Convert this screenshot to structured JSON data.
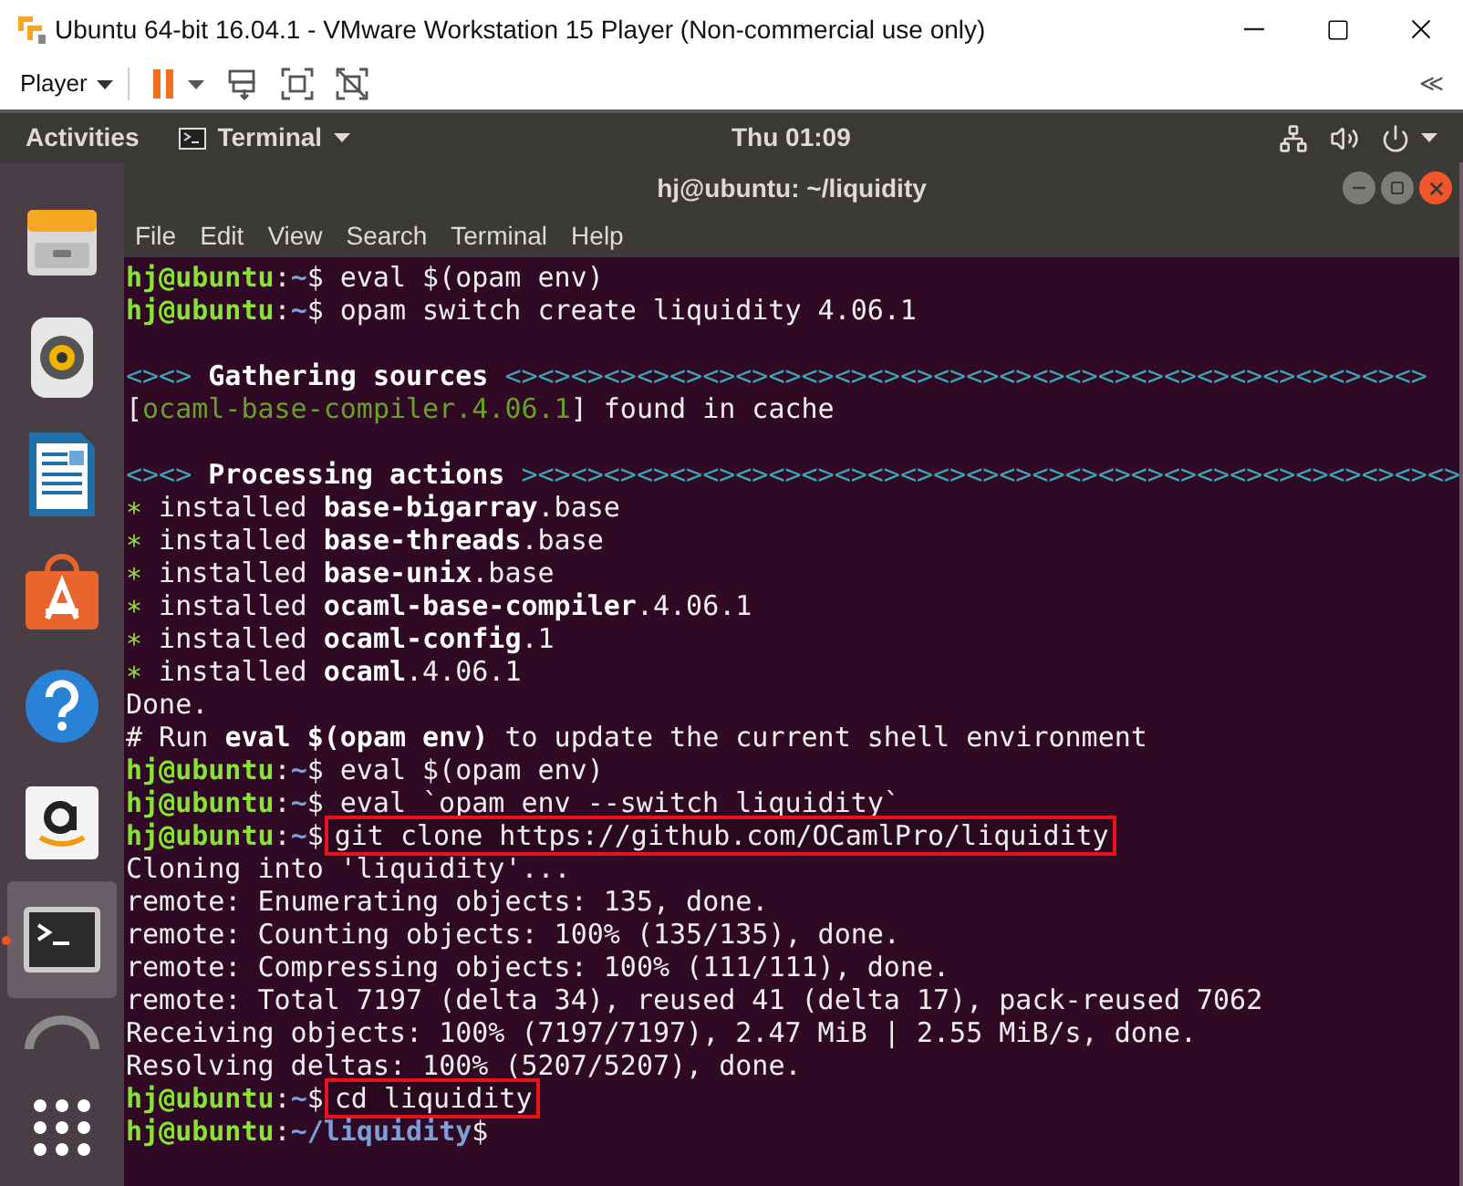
{
  "vmware": {
    "title": "Ubuntu 64-bit 16.04.1 - VMware Workstation 15 Player (Non-commercial use only)",
    "player_menu": "Player",
    "collapse": "≪"
  },
  "topbar": {
    "activities": "Activities",
    "app_menu": "Terminal",
    "clock": "Thu 01:09"
  },
  "launcher": [
    {
      "kind": "files",
      "selected": false
    },
    {
      "kind": "speaker",
      "selected": false
    },
    {
      "kind": "document",
      "selected": false
    },
    {
      "kind": "store",
      "selected": false
    },
    {
      "kind": "help",
      "selected": false
    },
    {
      "kind": "amazon",
      "selected": false
    },
    {
      "kind": "terminal",
      "selected": true
    },
    {
      "kind": "partial",
      "selected": false
    },
    {
      "kind": "apps",
      "selected": false
    }
  ],
  "terminal": {
    "title": "hj@ubuntu: ~/liquidity",
    "menu": [
      "File",
      "Edit",
      "View",
      "Search",
      "Terminal",
      "Help"
    ],
    "lines": [
      {
        "kind": "prompt",
        "user": "hj@ubuntu",
        "sep": ":",
        "path": "~",
        "dollar": "$",
        "command": "eval $(opam env)",
        "boxed": false
      },
      {
        "kind": "prompt",
        "user": "hj@ubuntu",
        "sep": ":",
        "path": "~",
        "dollar": "$",
        "command": "opam switch create liquidity 4.06.1",
        "boxed": false
      },
      {
        "kind": "blank"
      },
      {
        "kind": "output",
        "segments": [
          {
            "text": "<><>",
            "kind": "divider"
          },
          {
            "text": " Gathering sources ",
            "kind": "bold"
          },
          {
            "text": "<><><><><><><><><><><><><><><><><><><><><><><><><><><><>",
            "kind": "divider"
          }
        ]
      },
      {
        "kind": "output",
        "segments": [
          {
            "text": "[",
            "kind": "text"
          },
          {
            "text": "ocaml-base-compiler.4.06.1",
            "kind": "package"
          },
          {
            "text": "] found in cache",
            "kind": "text"
          }
        ]
      },
      {
        "kind": "blank"
      },
      {
        "kind": "output",
        "segments": [
          {
            "text": "<><>",
            "kind": "divider"
          },
          {
            "text": " Processing actions ",
            "kind": "bold"
          },
          {
            "text": "><><><><><><><><><><><><><><><><><><><><><><><><><><><><>",
            "kind": "divider"
          }
        ]
      },
      {
        "kind": "output",
        "segments": [
          {
            "text": "∗",
            "kind": "bullet"
          },
          {
            "text": " installed ",
            "kind": "text"
          },
          {
            "text": "base-bigarray",
            "kind": "bold"
          },
          {
            "text": ".base",
            "kind": "text"
          }
        ]
      },
      {
        "kind": "output",
        "segments": [
          {
            "text": "∗",
            "kind": "bullet"
          },
          {
            "text": " installed ",
            "kind": "text"
          },
          {
            "text": "base-threads",
            "kind": "bold"
          },
          {
            "text": ".base",
            "kind": "text"
          }
        ]
      },
      {
        "kind": "output",
        "segments": [
          {
            "text": "∗",
            "kind": "bullet"
          },
          {
            "text": " installed ",
            "kind": "text"
          },
          {
            "text": "base-unix",
            "kind": "bold"
          },
          {
            "text": ".base",
            "kind": "text"
          }
        ]
      },
      {
        "kind": "output",
        "segments": [
          {
            "text": "∗",
            "kind": "bullet"
          },
          {
            "text": " installed ",
            "kind": "text"
          },
          {
            "text": "ocaml-base-compiler",
            "kind": "bold"
          },
          {
            "text": ".4.06.1",
            "kind": "text"
          }
        ]
      },
      {
        "kind": "output",
        "segments": [
          {
            "text": "∗",
            "kind": "bullet"
          },
          {
            "text": " installed ",
            "kind": "text"
          },
          {
            "text": "ocaml-config",
            "kind": "bold"
          },
          {
            "text": ".1",
            "kind": "text"
          }
        ]
      },
      {
        "kind": "output",
        "segments": [
          {
            "text": "∗",
            "kind": "bullet"
          },
          {
            "text": " installed ",
            "kind": "text"
          },
          {
            "text": "ocaml",
            "kind": "bold"
          },
          {
            "text": ".4.06.1",
            "kind": "text"
          }
        ]
      },
      {
        "kind": "output",
        "segments": [
          {
            "text": "Done.",
            "kind": "text"
          }
        ]
      },
      {
        "kind": "output",
        "segments": [
          {
            "text": "# Run ",
            "kind": "text"
          },
          {
            "text": "eval $(opam env)",
            "kind": "bold"
          },
          {
            "text": " to update the current shell environment",
            "kind": "text"
          }
        ]
      },
      {
        "kind": "prompt",
        "user": "hj@ubuntu",
        "sep": ":",
        "path": "~",
        "dollar": "$",
        "command": "eval $(opam env)",
        "boxed": false
      },
      {
        "kind": "prompt",
        "user": "hj@ubuntu",
        "sep": ":",
        "path": "~",
        "dollar": "$",
        "command": "eval `opam env --switch liquidity`",
        "boxed": false
      },
      {
        "kind": "prompt",
        "user": "hj@ubuntu",
        "sep": ":",
        "path": "~",
        "dollar": "$",
        "command": "git clone https://github.com/OCamlPro/liquidity",
        "boxed": true
      },
      {
        "kind": "output",
        "segments": [
          {
            "text": "Cloning into 'liquidity'...",
            "kind": "text"
          }
        ]
      },
      {
        "kind": "output",
        "segments": [
          {
            "text": "remote: Enumerating objects: 135, done.",
            "kind": "text"
          }
        ]
      },
      {
        "kind": "output",
        "segments": [
          {
            "text": "remote: Counting objects: 100% (135/135), done.",
            "kind": "text"
          }
        ]
      },
      {
        "kind": "output",
        "segments": [
          {
            "text": "remote: Compressing objects: 100% (111/111), done.",
            "kind": "text"
          }
        ]
      },
      {
        "kind": "output",
        "segments": [
          {
            "text": "remote: Total 7197 (delta 34), reused 41 (delta 17), pack-reused 7062",
            "kind": "text"
          }
        ]
      },
      {
        "kind": "output",
        "segments": [
          {
            "text": "Receiving objects: 100% (7197/7197), 2.47 MiB | 2.55 MiB/s, done.",
            "kind": "text"
          }
        ]
      },
      {
        "kind": "output",
        "segments": [
          {
            "text": "Resolving deltas: 100% (5207/5207), done.",
            "kind": "text"
          }
        ]
      },
      {
        "kind": "prompt",
        "user": "hj@ubuntu",
        "sep": ":",
        "path": "~",
        "dollar": "$",
        "command": "cd liquidity",
        "boxed": true
      },
      {
        "kind": "prompt",
        "user": "hj@ubuntu",
        "sep": ":",
        "path": "~/liquidity",
        "dollar": "$"
      }
    ]
  }
}
